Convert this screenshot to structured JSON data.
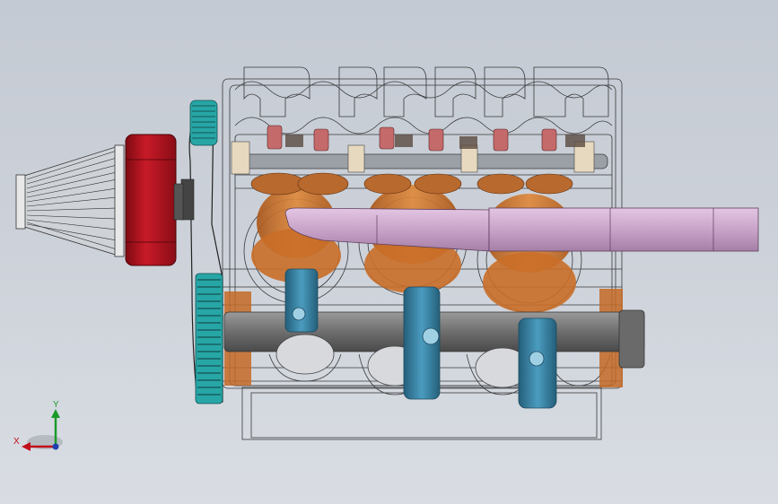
{
  "viewport": {
    "background_top": "#c4cad3",
    "background_bottom": "#d9dde3"
  },
  "triad": {
    "x_label": "X",
    "y_label": "Y",
    "x_color": "#c0101a",
    "y_color": "#1a9a2a",
    "z_color": "#1f3fb0"
  },
  "model": {
    "parts": [
      {
        "name": "air-filter",
        "color": "#cfd3d8"
      },
      {
        "name": "intake-housing",
        "color": "#b3121f"
      },
      {
        "name": "timing-belt",
        "color": "#2b2b2b"
      },
      {
        "name": "cam-pulley",
        "color": "#27a6a6"
      },
      {
        "name": "crank-pulley",
        "color": "#27a6a6"
      },
      {
        "name": "exhaust-pipe",
        "color": "#c9a3c9"
      },
      {
        "name": "pistons",
        "color": "#d0762a"
      },
      {
        "name": "connecting-rods",
        "color": "#3a86a8"
      },
      {
        "name": "crankshaft",
        "color": "#7c7c7c"
      },
      {
        "name": "spark-plugs",
        "color": "#c46a6a"
      },
      {
        "name": "rocker-shaft",
        "color": "#9aa0a6"
      },
      {
        "name": "engine-block-wireframe",
        "color": "#1a1a1a"
      }
    ]
  }
}
